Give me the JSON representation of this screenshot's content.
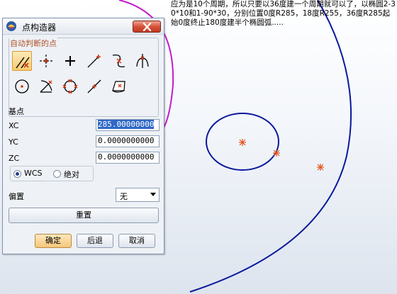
{
  "note": {
    "text": "应为是10个周期，所以只要以36度建一个周期就可以了，以椭圆2-30*10和1-90*30，分别位置0度R285，18度R255，36度R285起始0度终止180度建半个椭圆弧....."
  },
  "dialog": {
    "title": "点构造器",
    "auto_group_label": "自动判断的点",
    "tools": [
      {
        "icon": "inferred-point-icon",
        "selected": true
      },
      {
        "icon": "cursor-location-icon"
      },
      {
        "icon": "existing-point-icon"
      },
      {
        "icon": "end-point-icon"
      },
      {
        "icon": "control-point-icon"
      },
      {
        "icon": "intersection-point-icon"
      },
      {
        "icon": "arc-center-icon"
      },
      {
        "icon": "angle-on-arc-icon"
      },
      {
        "icon": "quadrant-point-icon"
      },
      {
        "icon": "point-on-curve-icon"
      },
      {
        "icon": "point-on-surface-icon"
      }
    ],
    "base_point_label": "基点",
    "fields": [
      {
        "label": "XC",
        "value": "285.00000000",
        "selected": true
      },
      {
        "label": "YC",
        "value": "0.0000000000"
      },
      {
        "label": "ZC",
        "value": "0.0000000000"
      }
    ],
    "radio": [
      {
        "label": "WCS",
        "checked": true
      },
      {
        "label": "绝对",
        "checked": false
      }
    ],
    "offset_label": "偏置",
    "offset_value": "无",
    "reset_label": "重置",
    "ok_label": "确定",
    "back_label": "后退",
    "cancel_label": "取消"
  },
  "colors": {
    "curve_blue": "#0a1a9c",
    "arc_magenta": "#c21bc9",
    "point_marker": "#e5531a"
  }
}
